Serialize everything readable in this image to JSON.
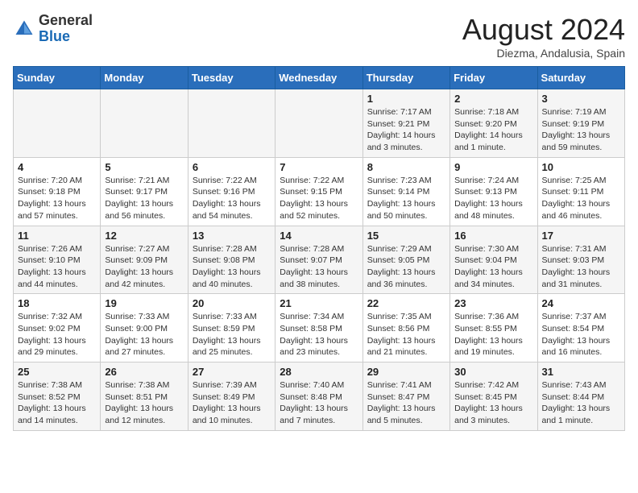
{
  "header": {
    "logo_general": "General",
    "logo_blue": "Blue",
    "month_title": "August 2024",
    "location": "Diezma, Andalusia, Spain"
  },
  "weekdays": [
    "Sunday",
    "Monday",
    "Tuesday",
    "Wednesday",
    "Thursday",
    "Friday",
    "Saturday"
  ],
  "weeks": [
    [
      {
        "day": "",
        "content": ""
      },
      {
        "day": "",
        "content": ""
      },
      {
        "day": "",
        "content": ""
      },
      {
        "day": "",
        "content": ""
      },
      {
        "day": "1",
        "content": "Sunrise: 7:17 AM\nSunset: 9:21 PM\nDaylight: 14 hours\nand 3 minutes."
      },
      {
        "day": "2",
        "content": "Sunrise: 7:18 AM\nSunset: 9:20 PM\nDaylight: 14 hours\nand 1 minute."
      },
      {
        "day": "3",
        "content": "Sunrise: 7:19 AM\nSunset: 9:19 PM\nDaylight: 13 hours\nand 59 minutes."
      }
    ],
    [
      {
        "day": "4",
        "content": "Sunrise: 7:20 AM\nSunset: 9:18 PM\nDaylight: 13 hours\nand 57 minutes."
      },
      {
        "day": "5",
        "content": "Sunrise: 7:21 AM\nSunset: 9:17 PM\nDaylight: 13 hours\nand 56 minutes."
      },
      {
        "day": "6",
        "content": "Sunrise: 7:22 AM\nSunset: 9:16 PM\nDaylight: 13 hours\nand 54 minutes."
      },
      {
        "day": "7",
        "content": "Sunrise: 7:22 AM\nSunset: 9:15 PM\nDaylight: 13 hours\nand 52 minutes."
      },
      {
        "day": "8",
        "content": "Sunrise: 7:23 AM\nSunset: 9:14 PM\nDaylight: 13 hours\nand 50 minutes."
      },
      {
        "day": "9",
        "content": "Sunrise: 7:24 AM\nSunset: 9:13 PM\nDaylight: 13 hours\nand 48 minutes."
      },
      {
        "day": "10",
        "content": "Sunrise: 7:25 AM\nSunset: 9:11 PM\nDaylight: 13 hours\nand 46 minutes."
      }
    ],
    [
      {
        "day": "11",
        "content": "Sunrise: 7:26 AM\nSunset: 9:10 PM\nDaylight: 13 hours\nand 44 minutes."
      },
      {
        "day": "12",
        "content": "Sunrise: 7:27 AM\nSunset: 9:09 PM\nDaylight: 13 hours\nand 42 minutes."
      },
      {
        "day": "13",
        "content": "Sunrise: 7:28 AM\nSunset: 9:08 PM\nDaylight: 13 hours\nand 40 minutes."
      },
      {
        "day": "14",
        "content": "Sunrise: 7:28 AM\nSunset: 9:07 PM\nDaylight: 13 hours\nand 38 minutes."
      },
      {
        "day": "15",
        "content": "Sunrise: 7:29 AM\nSunset: 9:05 PM\nDaylight: 13 hours\nand 36 minutes."
      },
      {
        "day": "16",
        "content": "Sunrise: 7:30 AM\nSunset: 9:04 PM\nDaylight: 13 hours\nand 34 minutes."
      },
      {
        "day": "17",
        "content": "Sunrise: 7:31 AM\nSunset: 9:03 PM\nDaylight: 13 hours\nand 31 minutes."
      }
    ],
    [
      {
        "day": "18",
        "content": "Sunrise: 7:32 AM\nSunset: 9:02 PM\nDaylight: 13 hours\nand 29 minutes."
      },
      {
        "day": "19",
        "content": "Sunrise: 7:33 AM\nSunset: 9:00 PM\nDaylight: 13 hours\nand 27 minutes."
      },
      {
        "day": "20",
        "content": "Sunrise: 7:33 AM\nSunset: 8:59 PM\nDaylight: 13 hours\nand 25 minutes."
      },
      {
        "day": "21",
        "content": "Sunrise: 7:34 AM\nSunset: 8:58 PM\nDaylight: 13 hours\nand 23 minutes."
      },
      {
        "day": "22",
        "content": "Sunrise: 7:35 AM\nSunset: 8:56 PM\nDaylight: 13 hours\nand 21 minutes."
      },
      {
        "day": "23",
        "content": "Sunrise: 7:36 AM\nSunset: 8:55 PM\nDaylight: 13 hours\nand 19 minutes."
      },
      {
        "day": "24",
        "content": "Sunrise: 7:37 AM\nSunset: 8:54 PM\nDaylight: 13 hours\nand 16 minutes."
      }
    ],
    [
      {
        "day": "25",
        "content": "Sunrise: 7:38 AM\nSunset: 8:52 PM\nDaylight: 13 hours\nand 14 minutes."
      },
      {
        "day": "26",
        "content": "Sunrise: 7:38 AM\nSunset: 8:51 PM\nDaylight: 13 hours\nand 12 minutes."
      },
      {
        "day": "27",
        "content": "Sunrise: 7:39 AM\nSunset: 8:49 PM\nDaylight: 13 hours\nand 10 minutes."
      },
      {
        "day": "28",
        "content": "Sunrise: 7:40 AM\nSunset: 8:48 PM\nDaylight: 13 hours\nand 7 minutes."
      },
      {
        "day": "29",
        "content": "Sunrise: 7:41 AM\nSunset: 8:47 PM\nDaylight: 13 hours\nand 5 minutes."
      },
      {
        "day": "30",
        "content": "Sunrise: 7:42 AM\nSunset: 8:45 PM\nDaylight: 13 hours\nand 3 minutes."
      },
      {
        "day": "31",
        "content": "Sunrise: 7:43 AM\nSunset: 8:44 PM\nDaylight: 13 hours\nand 1 minute."
      }
    ]
  ]
}
